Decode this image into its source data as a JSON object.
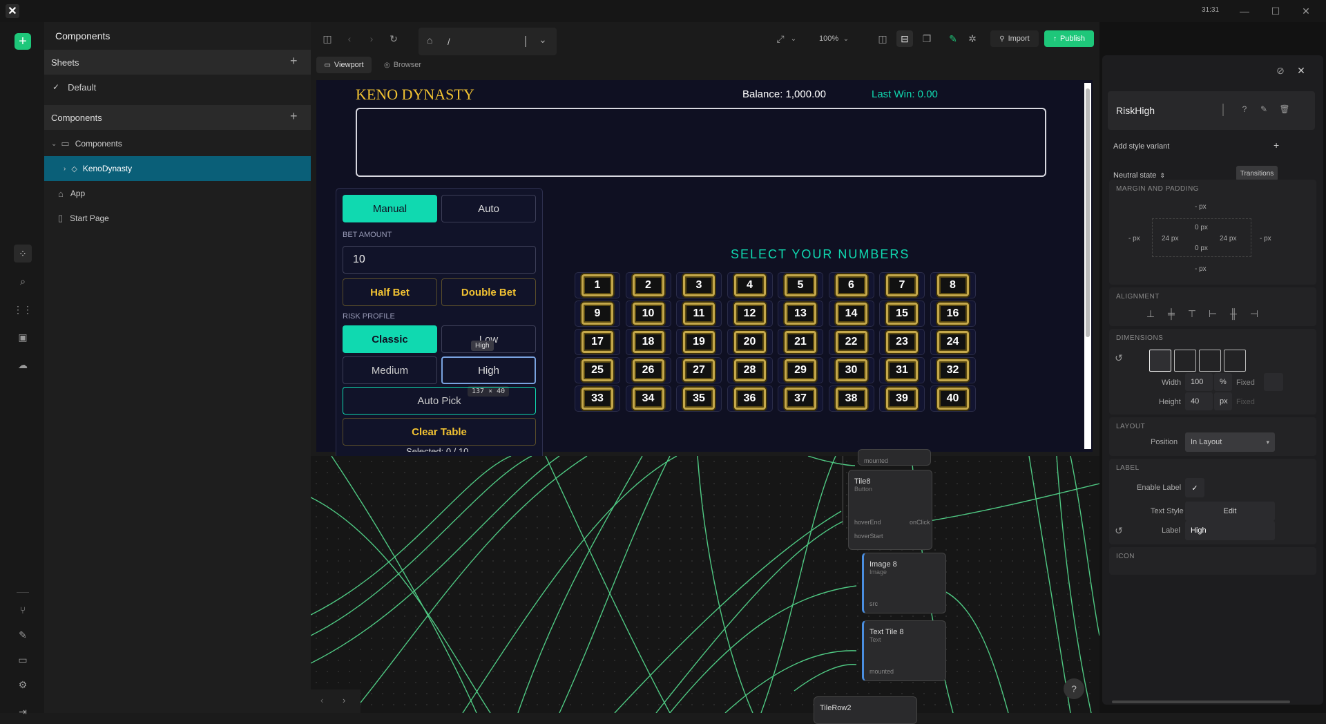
{
  "titlebar": {
    "time": "31:31"
  },
  "left_panel": {
    "title": "Components",
    "sheets_header": "Sheets",
    "sheets": [
      {
        "label": "Default",
        "checked": true
      }
    ],
    "components_header": "Components",
    "tree": [
      {
        "label": "Components",
        "kind": "folder"
      },
      {
        "label": "KenoDynasty",
        "kind": "component",
        "selected": true
      },
      {
        "label": "App",
        "kind": "home"
      },
      {
        "label": "Start Page",
        "kind": "page"
      }
    ]
  },
  "toolbar": {
    "path": "/",
    "zoom": "100%",
    "import_label": "Import",
    "publish_label": "Publish",
    "tab_viewport": "Viewport",
    "tab_browser": "Browser"
  },
  "game": {
    "title": "KENO DYNASTY",
    "balance": "Balance: 1,000.00",
    "last_win": "Last Win: 0.00",
    "manual": "Manual",
    "auto": "Auto",
    "bet_amount_label": "BET AMOUNT",
    "bet_value": "10",
    "half_bet": "Half Bet",
    "double_bet": "Double Bet",
    "risk_profile_label": "RISK PROFILE",
    "classic": "Classic",
    "low": "Low",
    "medium": "Medium",
    "high": "High",
    "tooltip": "High",
    "size_badge": "137 × 40",
    "auto_pick": "Auto Pick",
    "clear_table": "Clear Table",
    "selected": "Selected: 0 / 10",
    "select_heading": "SELECT YOUR NUMBERS",
    "numbers": [
      "1",
      "2",
      "3",
      "4",
      "5",
      "6",
      "7",
      "8",
      "9",
      "10",
      "11",
      "12",
      "13",
      "14",
      "15",
      "16",
      "17",
      "18",
      "19",
      "20",
      "21",
      "22",
      "23",
      "24",
      "25",
      "26",
      "27",
      "28",
      "29",
      "30",
      "31",
      "32",
      "33",
      "34",
      "35",
      "36",
      "37",
      "38",
      "39",
      "40"
    ]
  },
  "graph": {
    "nodes": [
      {
        "title": "",
        "port": "mounted"
      },
      {
        "title": "Tile8",
        "sub": "Button",
        "ports": [
          "hoverEnd",
          "hoverStart",
          "onClick"
        ]
      },
      {
        "title": "Image 8",
        "sub": "Image",
        "ports": [
          "src"
        ]
      },
      {
        "title": "Text Tile 8",
        "sub": "Text",
        "ports": [
          "mounted"
        ]
      },
      {
        "title": "TileRow2"
      }
    ],
    "help": "?"
  },
  "inspector": {
    "name": "RiskHigh",
    "add_style_variant": "Add style variant",
    "neutral_state": "Neutral state",
    "transitions": "Transitions",
    "margin_padding_title": "MARGIN AND PADDING",
    "margin_top": "- px",
    "margin_left": "- px",
    "margin_right": "- px",
    "margin_bottom": "- px",
    "padding_top": "0 px",
    "padding_left": "24 px",
    "padding_right": "24 px",
    "padding_bottom": "0 px",
    "alignment_title": "ALIGNMENT",
    "dimensions_title": "DIMENSIONS",
    "width_label": "Width",
    "width_value": "100",
    "width_unit": "%",
    "width_fixed": "Fixed",
    "height_label": "Height",
    "height_value": "40",
    "height_unit": "px",
    "height_fixed": "Fixed",
    "layout_title": "LAYOUT",
    "position_label": "Position",
    "position_value": "In Layout",
    "label_title": "LABEL",
    "enable_label": "Enable Label",
    "text_style": "Text Style",
    "edit": "Edit",
    "label_label": "Label",
    "label_value": "High",
    "icon_title": "ICON"
  },
  "colors": {
    "accent": "#10d9b0",
    "gold": "#f1c232",
    "publish": "#1ec77a",
    "select": "#0a5f78"
  }
}
